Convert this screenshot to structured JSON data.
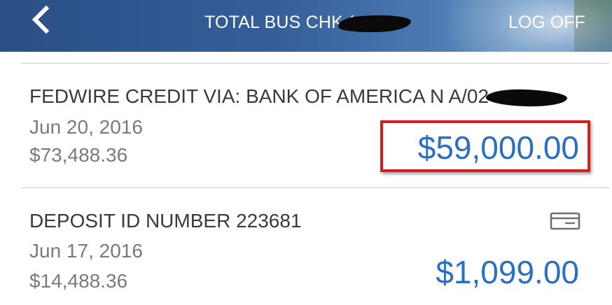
{
  "header": {
    "title": "TOTAL BUS CHK (",
    "logoff_label": "LOG OFF",
    "back_icon": "chevron-left-icon"
  },
  "transactions": [
    {
      "description": "FEDWIRE CREDIT VIA: BANK OF AMERICA N A/02",
      "date": "Jun 20, 2016",
      "balance": "$73,488.36",
      "amount": "$59,000.00",
      "highlighted": true
    },
    {
      "description": "DEPOSIT ID NUMBER 223681",
      "date": "Jun 17, 2016",
      "balance": "$14,488.36",
      "amount": "$1,099.00",
      "icon": "check-deposit-icon"
    }
  ],
  "colors": {
    "header_bg": "#2f5a94",
    "amount": "#2b6fc0",
    "highlight": "#d21e1e"
  }
}
